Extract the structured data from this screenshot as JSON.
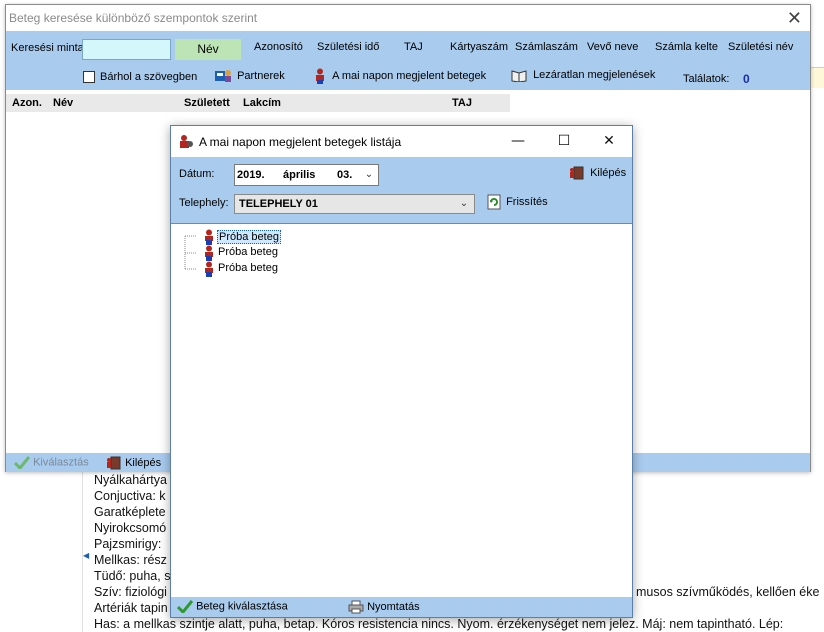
{
  "background_document": {
    "lines": [
      "Nyálkahártya",
      "Conjuctiva: k",
      "Garatképlete",
      "Nyirokcsomó",
      "Pajzsmirigy:",
      "Mellkas: rész",
      "Tüdő: puha, s",
      "Szív: fiziológi",
      "Artériák tapin",
      "Has: a mellkas szintje alatt, puha, betap. Kóros resistencia nincs. Nyom. érzékenységet nem jelez. Máj: nem tapintható. Lép:"
    ],
    "right_fragment": "musos szívműködés, kellően éke"
  },
  "search_window": {
    "title": "Beteg keresése különböző szempontok szerint",
    "search_label": "Keresési minta:",
    "search_value": "",
    "nev_button": "Név",
    "criteria": [
      "Azonosító",
      "Születési idő",
      "TAJ",
      "Kártyaszám",
      "Számlaszám",
      "Vevő neve",
      "Számla kelte",
      "Születési név"
    ],
    "anywhere_checkbox_label": "Bárhol a szövegben",
    "anywhere_checked": false,
    "partners_button": "Partnerek",
    "today_patients_button": "A mai napon megjelent betegek",
    "unclosed_button": "Lezáratlan megjelenések",
    "results_label": "Találatok:",
    "results_count": "0",
    "columns": [
      "Azon.",
      "Név",
      "Született",
      "Lakcím",
      "TAJ"
    ],
    "status": {
      "select_label": "Kiválasztás",
      "exit_label": "Kilépés"
    }
  },
  "dialog": {
    "title": "A mai napon megjelent betegek listája",
    "date_label": "Dátum:",
    "date": {
      "year": "2019.",
      "month": "április",
      "day": "03."
    },
    "exit_label": "Kilépés",
    "site_label": "Telephely:",
    "site_value": "TELEPHELY 01",
    "refresh_label": "Frissítés",
    "patients": [
      "Próba beteg",
      "Próba beteg",
      "Próba beteg"
    ],
    "selected_index": 0,
    "select_patient_label": "Beteg kiválasztása",
    "print_label": "Nyomtatás"
  },
  "colors": {
    "toolbar": "#a9cbee",
    "search_input": "#d4f7fb",
    "nev_button": "#bde4b5",
    "count": "#1a2f9a"
  },
  "icons": [
    "close-icon",
    "partners-icon",
    "person-icon",
    "book-icon",
    "checkmark-icon",
    "exit-door-icon",
    "patient-icon",
    "refresh-icon",
    "printer-icon",
    "minimize-icon",
    "maximize-icon",
    "chevron-down-icon"
  ]
}
